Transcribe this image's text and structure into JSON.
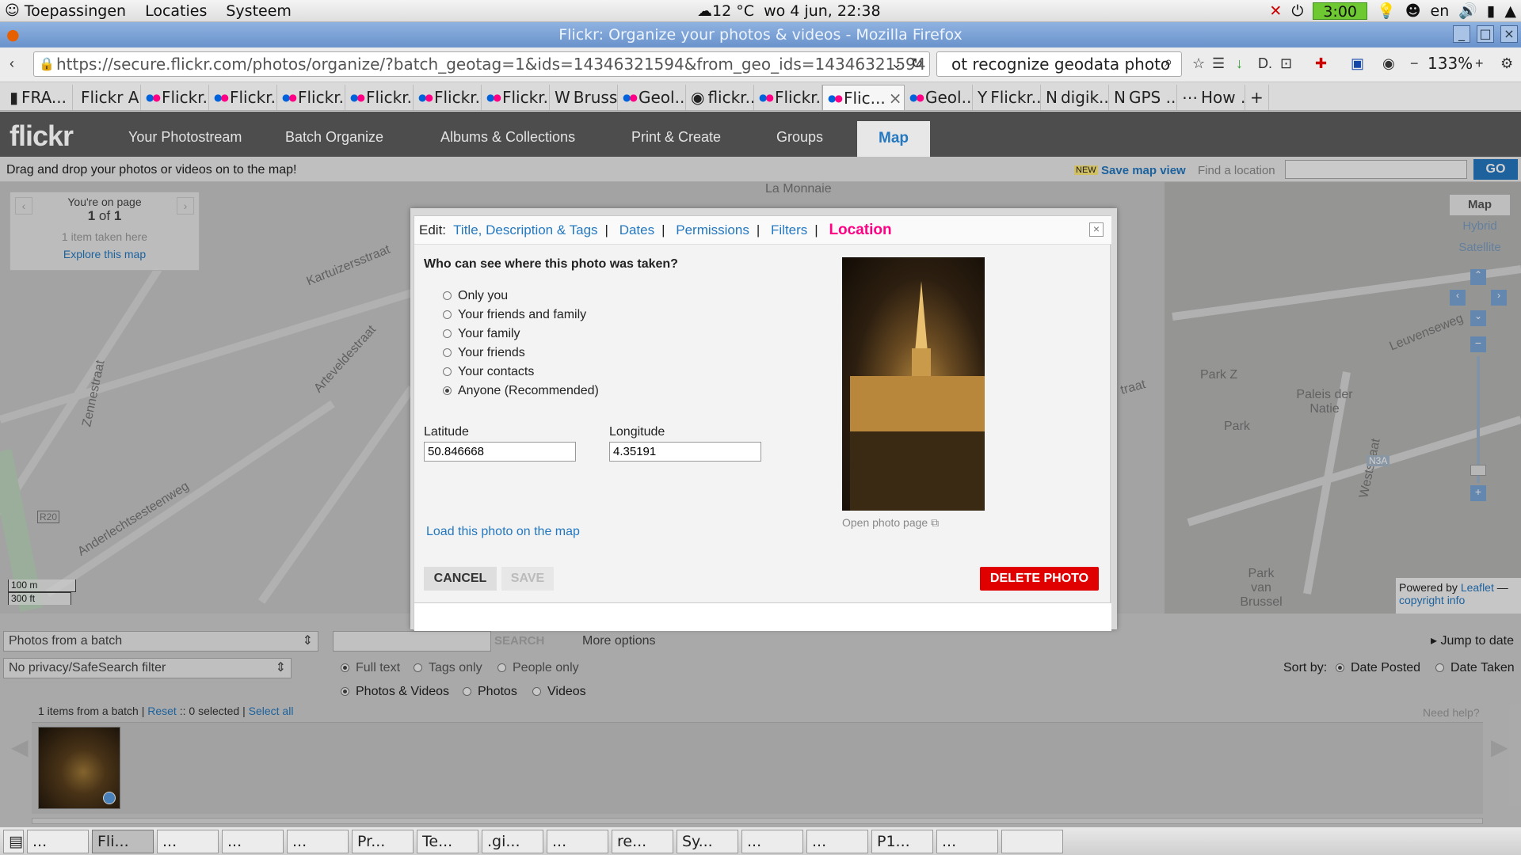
{
  "system_panel": {
    "menus": [
      "Toepassingen",
      "Locaties",
      "Systeem"
    ],
    "weather": "12 °C",
    "datetime": "wo  4 jun, 22:38",
    "battery": "3:00",
    "lang": "en"
  },
  "window": {
    "title": "Flickr: Organize your photos & videos - Mozilla Firefox"
  },
  "browser": {
    "url": "https://secure.flickr.com/photos/organize/?batch_geotag=1&ids=14346321594&from_geo_ids=14346321594",
    "search_text": "ot recognize geodata photo",
    "zoom": "133%",
    "tabs": [
      {
        "label": "FRA...",
        "icon": "page-icon"
      },
      {
        "label": "Flickr A...",
        "icon": "none"
      },
      {
        "label": "Flickr...",
        "icon": "flickr-icon"
      },
      {
        "label": "Flickr...",
        "icon": "flickr-icon"
      },
      {
        "label": "Flickr...",
        "icon": "flickr-icon"
      },
      {
        "label": "Flickr...",
        "icon": "flickr-icon"
      },
      {
        "label": "Flickr...",
        "icon": "flickr-icon"
      },
      {
        "label": "Flickr...",
        "icon": "flickr-icon"
      },
      {
        "label": "Bruss...",
        "icon": "wikipedia-icon"
      },
      {
        "label": "Geol...",
        "icon": "flickr-icon"
      },
      {
        "label": "flickr...",
        "icon": "orange-icon"
      },
      {
        "label": "Flickr...",
        "icon": "flickr-icon"
      },
      {
        "label": "Flic...",
        "icon": "flickr-icon",
        "active": true
      },
      {
        "label": "Geol...",
        "icon": "flickr-icon"
      },
      {
        "label": "Flickr...",
        "icon": "yahoo-icon"
      },
      {
        "label": "digik...",
        "icon": "n-icon"
      },
      {
        "label": "GPS ...",
        "icon": "n-icon"
      },
      {
        "label": "How ...",
        "icon": "dots-icon"
      }
    ]
  },
  "flickr": {
    "logo": "flickr",
    "nav": [
      "Your Photostream",
      "Batch Organize",
      "Albums & Collections",
      "Print & Create",
      "Groups",
      "Map"
    ],
    "drag_hint": "Drag and drop your photos or videos on to the map!",
    "new_badge": "NEW",
    "save_map_view": "Save map view",
    "find_location": "Find a location",
    "go": "GO",
    "pager": {
      "line1": "You're on page",
      "page": "1",
      "of": "of",
      "total": "1",
      "taken": "1 item taken here",
      "explore": "Explore this map"
    },
    "map_types": [
      "Map",
      "Hybrid",
      "Satellite"
    ],
    "streets": [
      "Kartuizersstraat",
      "Arteveldestraat",
      "Zennestraat",
      "Anderlechtsesteenweg",
      "Leuvenseweg",
      "Park",
      "Park Z",
      "Paleis der Natie",
      "Park van Brussel",
      "Weststraat",
      "La Monnaie",
      "R20",
      "N3A",
      "traat"
    ],
    "scale": [
      "100 m",
      "300 ft"
    ],
    "attribution": {
      "powered": "Powered by",
      "leaflet": "Leaflet",
      "dash": " —",
      "copyright": "copyright info"
    }
  },
  "lower": {
    "source_select": "Photos from a batch",
    "privacy_select": "No privacy/SafeSearch filter",
    "search_btn": "SEARCH",
    "more_options": "More options",
    "jump_to_date": "Jump to date",
    "search_modes": [
      "Full text",
      "Tags only",
      "People only"
    ],
    "media_types": [
      "Photos & Videos",
      "Photos",
      "Videos"
    ],
    "sort_by": "Sort by:",
    "sort_options": [
      "Date Posted",
      "Date Taken"
    ],
    "summary_pre": "1 items from a batch |",
    "reset": "Reset",
    "selected": ":: 0 selected |",
    "select_all": "Select all",
    "need_help": "Need help?"
  },
  "modal": {
    "edit_label": "Edit:",
    "tabs": [
      "Title, Description & Tags",
      "Dates",
      "Permissions",
      "Filters",
      "Location"
    ],
    "question": "Who can see where this photo was taken?",
    "options": [
      "Only you",
      "Your friends and family",
      "Your family",
      "Your friends",
      "Your contacts",
      "Anyone (Recommended)"
    ],
    "selected_option": "Anyone (Recommended)",
    "latitude_label": "Latitude",
    "latitude": "50.846668",
    "longitude_label": "Longitude",
    "longitude": "4.35191",
    "load_link": "Load this photo on the map",
    "open_photo": "Open photo page",
    "cancel": "CANCEL",
    "save": "SAVE",
    "delete": "DELETE PHOTO"
  },
  "taskbar": [
    "...",
    "Fli...",
    "...",
    "...",
    "...",
    "Pr...",
    "Te...",
    ".gi...",
    "...",
    "re...",
    "Sy...",
    "...",
    "...",
    "P1...",
    "...",
    ""
  ]
}
